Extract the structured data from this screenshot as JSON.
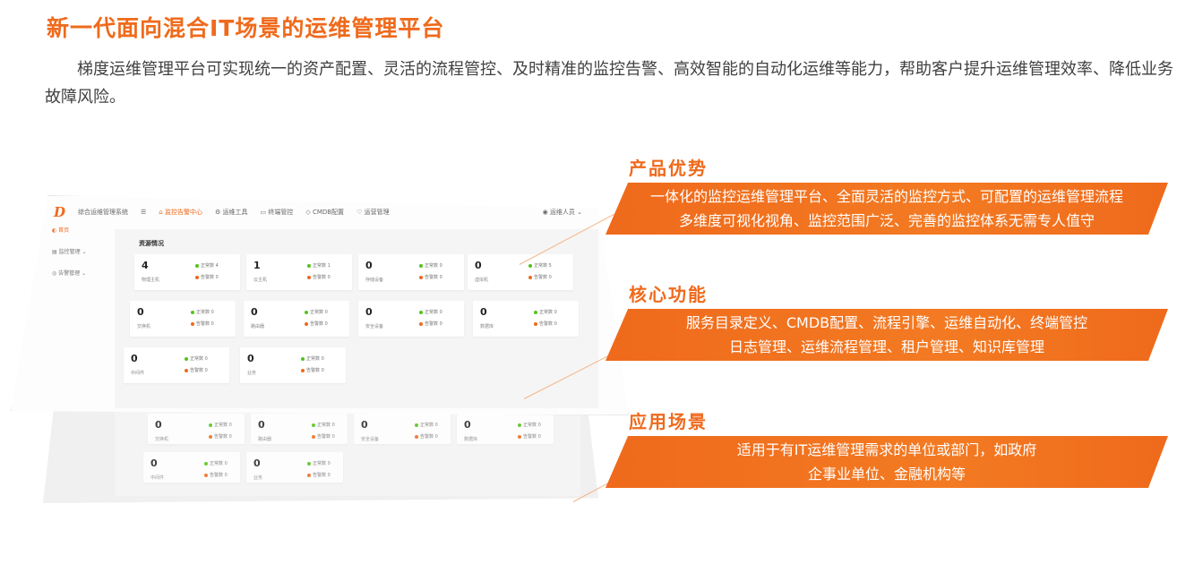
{
  "header": {
    "title": "新一代面向混合IT场景的运维管理平台",
    "intro": "梯度运维管理平台可实现统一的资产配置、灵活的流程管控、及时精准的监控告警、高效智能的自动化运维等能力，帮助客户提升运维管理效率、降低业务故障风险。"
  },
  "features": [
    {
      "heading": "产品优势",
      "lines": [
        "一体化的监控运维管理平台、全面灵活的监控方式、可配置的运维管理流程",
        "多维度可视化视角、监控范围广泛、完善的监控体系无需专人值守"
      ]
    },
    {
      "heading": "核心功能",
      "lines": [
        "服务目录定义、CMDB配置、流程引擎、运维自动化、终端管控",
        "日志管理、运维流程管理、租户管理、知识库管理"
      ]
    },
    {
      "heading": "应用场景",
      "lines": [
        "适用于有IT运维管理需求的单位或部门，如政府",
        "企事业单位、金融机构等"
      ]
    }
  ],
  "mockup": {
    "logo_glyph": "D",
    "app_name": "综合运维管理系统",
    "nav": [
      "监控告警中心",
      "运维工具",
      "终端管控",
      "CMDB配置",
      "运营管理"
    ],
    "user": "运维人员",
    "sidebar": [
      "首页",
      "监控管理",
      "告警管理"
    ],
    "section": "资源情况",
    "normal_label": "正常数",
    "alarm_label": "告警数",
    "cards": [
      {
        "name": "物理主机",
        "count": "4",
        "normal": "4",
        "alarm": "0"
      },
      {
        "name": "云主机",
        "count": "1",
        "normal": "1",
        "alarm": "0"
      },
      {
        "name": "存储设备",
        "count": "0",
        "normal": "0",
        "alarm": "0"
      },
      {
        "name": "虚拟机",
        "count": "0",
        "normal": "5",
        "alarm": "0"
      },
      {
        "name": "交换机",
        "count": "0",
        "normal": "0",
        "alarm": "0"
      },
      {
        "name": "路由器",
        "count": "0",
        "normal": "0",
        "alarm": "0"
      },
      {
        "name": "安全设备",
        "count": "0",
        "normal": "0",
        "alarm": "0"
      },
      {
        "name": "数据库",
        "count": "0",
        "normal": "0",
        "alarm": "0"
      },
      {
        "name": "中间件",
        "count": "0",
        "normal": "0",
        "alarm": "0"
      },
      {
        "name": "业务",
        "count": "0",
        "normal": "0",
        "alarm": "0"
      }
    ],
    "back_cards": [
      {
        "name": "交换机",
        "count": "0",
        "normal": "0",
        "alarm": "0"
      },
      {
        "name": "路由器",
        "count": "0",
        "normal": "0",
        "alarm": "0"
      },
      {
        "name": "安全设备",
        "count": "0",
        "normal": "0",
        "alarm": "0"
      },
      {
        "name": "数据库",
        "count": "0",
        "normal": "0",
        "alarm": "0"
      },
      {
        "name": "中间件",
        "count": "0",
        "normal": "0",
        "alarm": "0"
      },
      {
        "name": "业务",
        "count": "0",
        "normal": "0",
        "alarm": "0"
      }
    ]
  },
  "colors": {
    "accent": "#ef6a1c",
    "ok": "#52c41a"
  }
}
